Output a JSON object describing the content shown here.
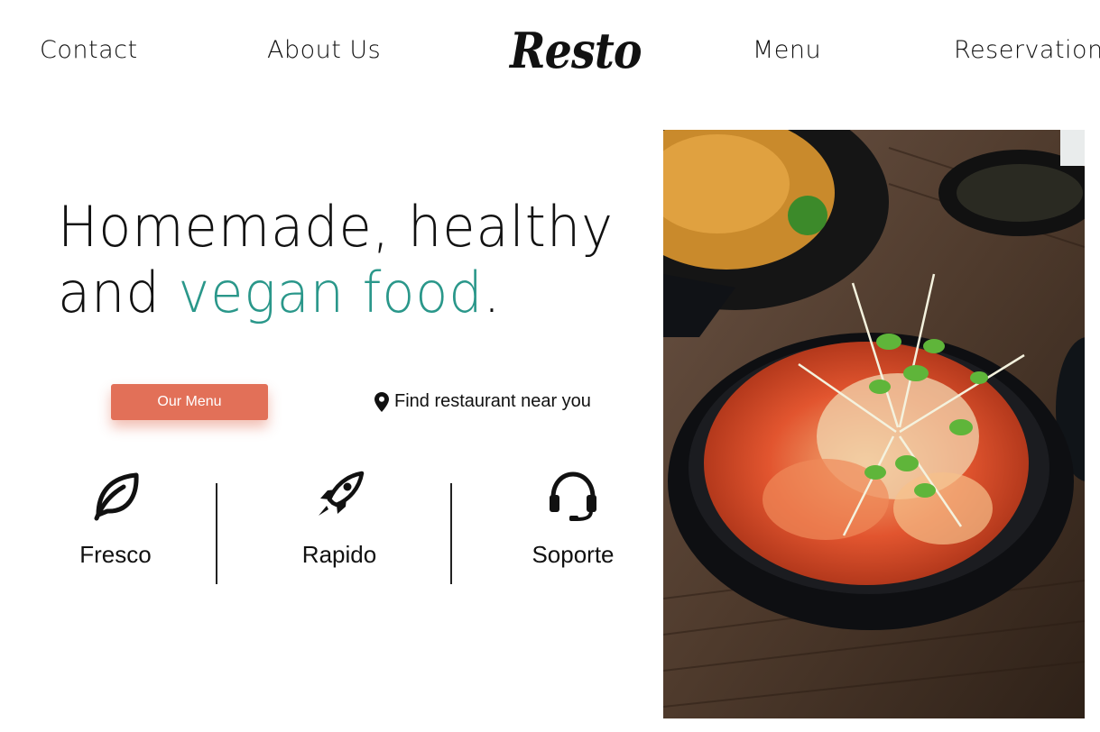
{
  "nav": {
    "contact": "Contact",
    "about": "About Us",
    "logo": "Resto",
    "menu": "Menu",
    "reservation": "Reservation"
  },
  "hero": {
    "title_line1": "Homemade, healthy",
    "title_line2_prefix": "and ",
    "title_line2_accent": "vegan food",
    "title_line2_suffix": ".",
    "cta_label": "Our Menu",
    "find_label": "Find restaurant near you"
  },
  "features": [
    {
      "label": "Fresco",
      "icon": "leaf-icon"
    },
    {
      "label": "Rapido",
      "icon": "rocket-icon"
    },
    {
      "label": "Soporte",
      "icon": "headset-icon"
    }
  ],
  "colors": {
    "accent": "#2a978a",
    "cta": "#e27058"
  }
}
